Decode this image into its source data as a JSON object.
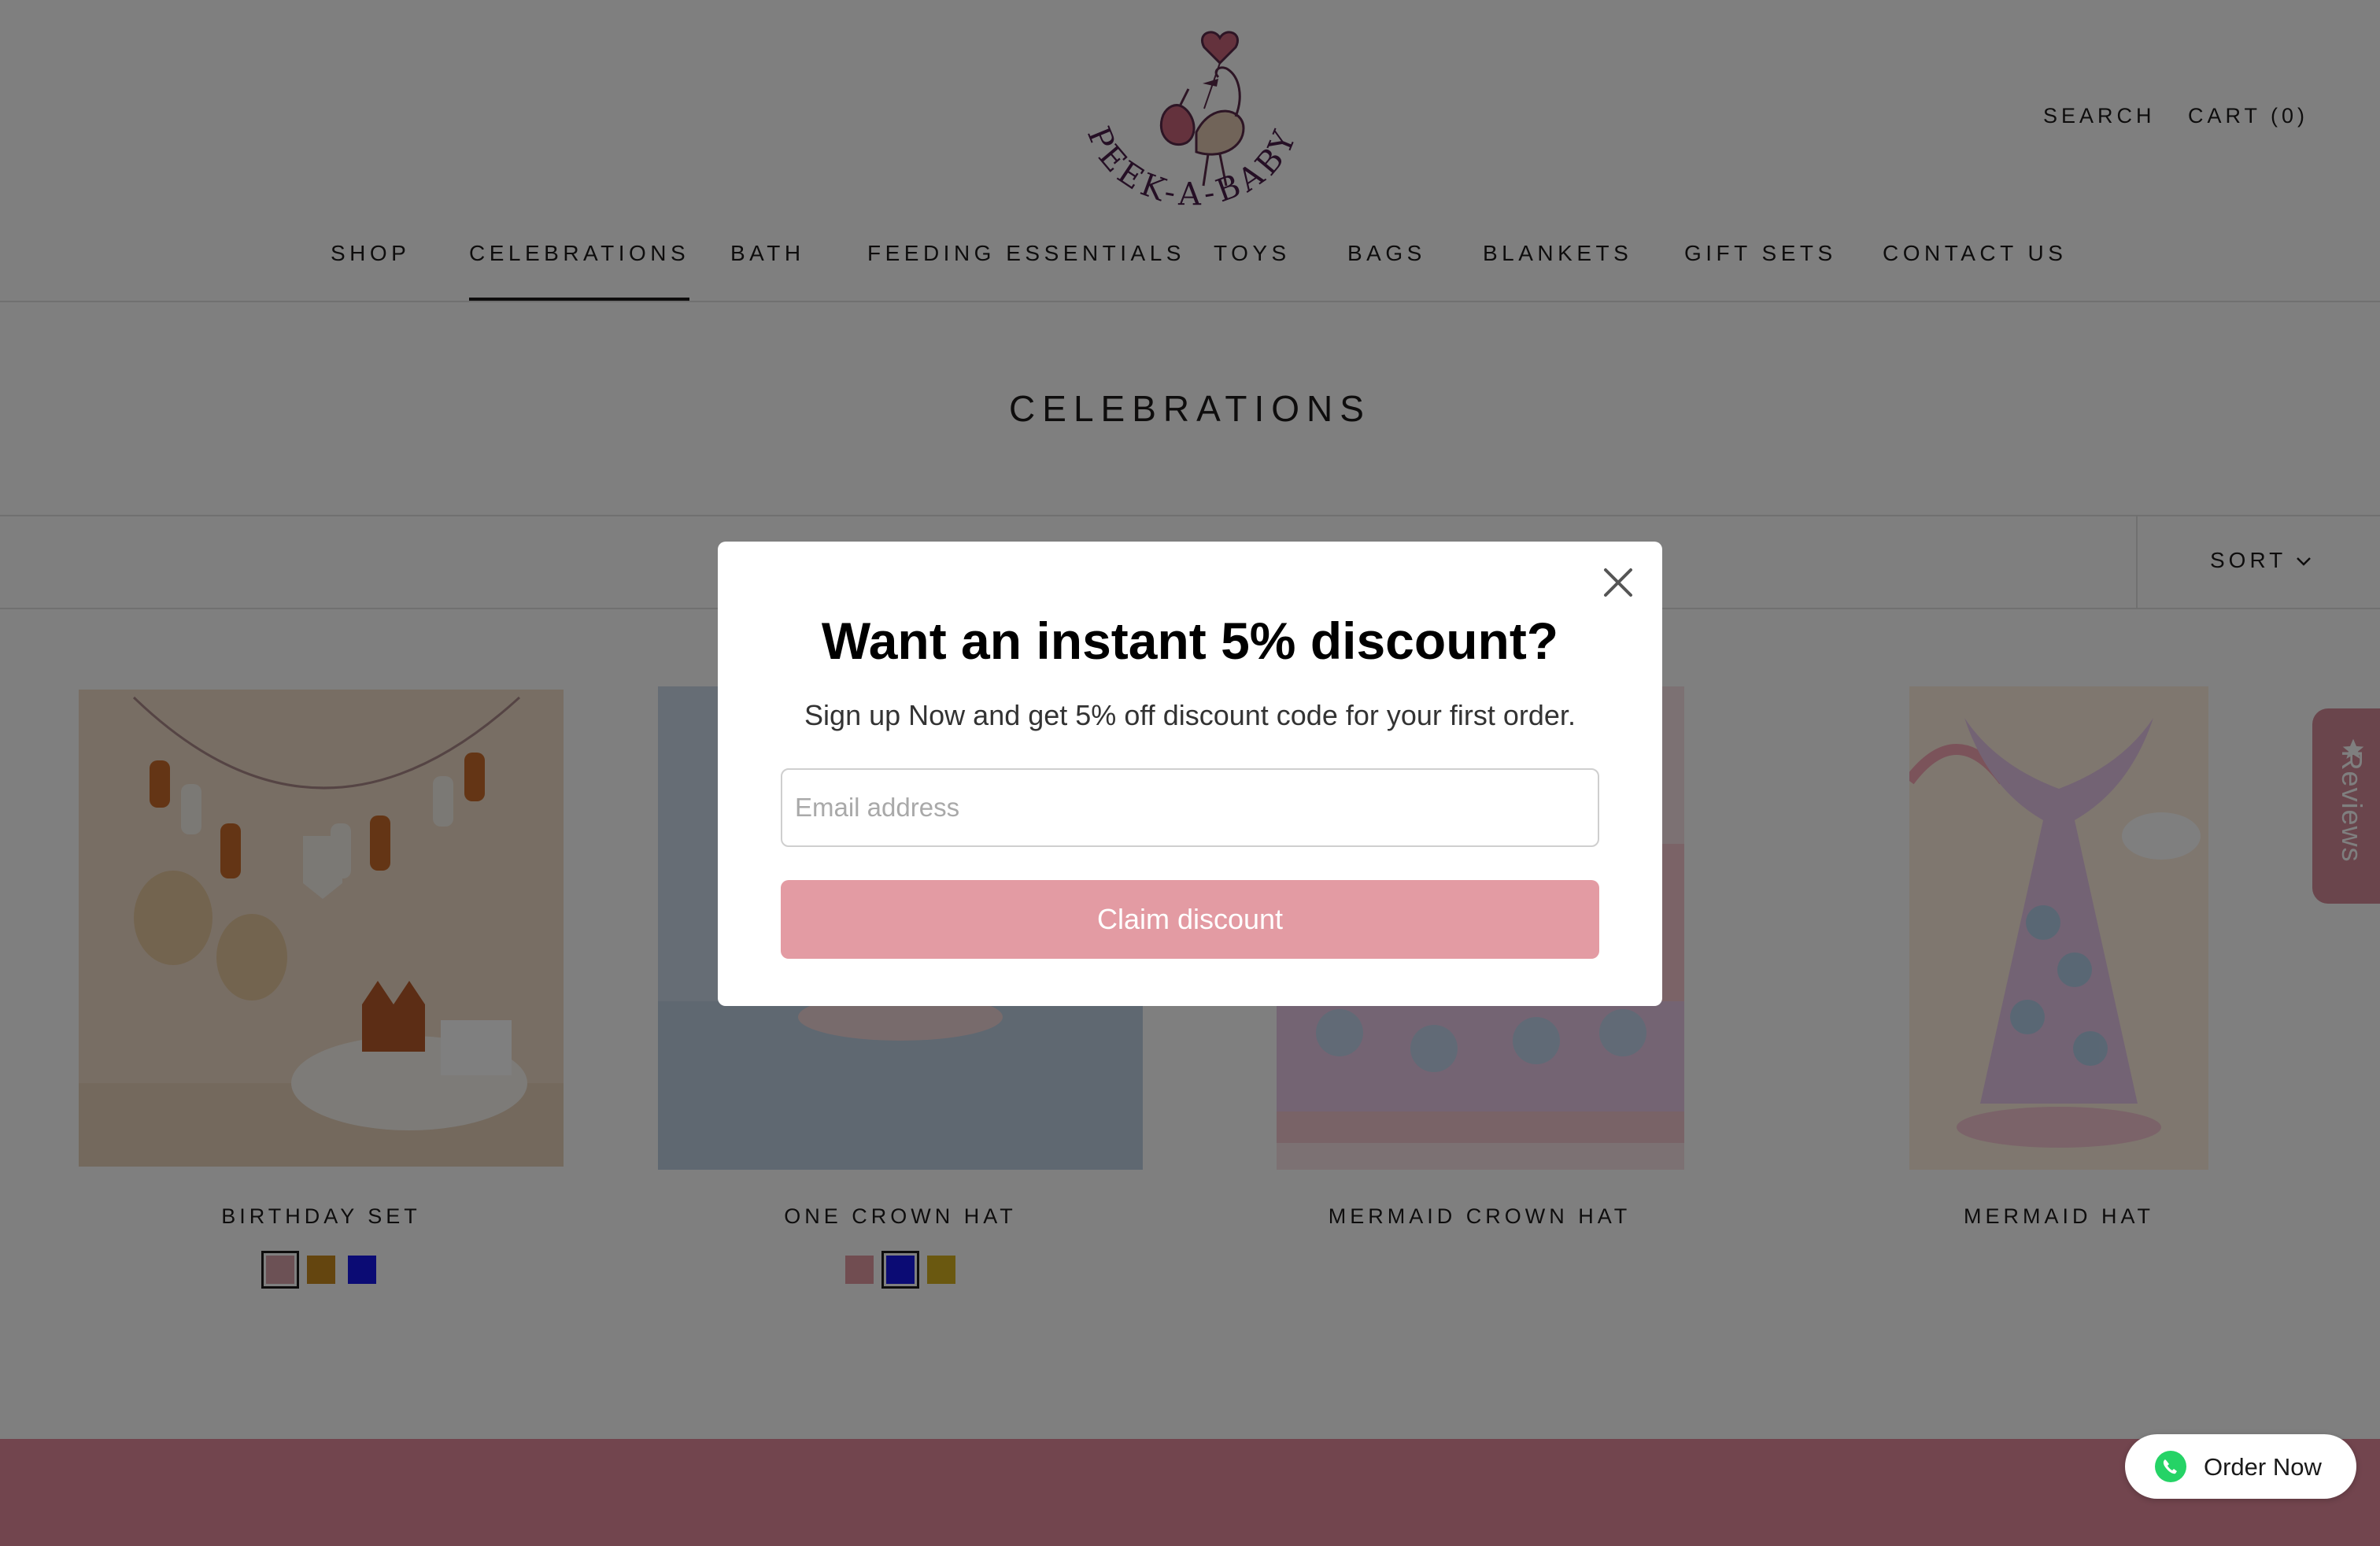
{
  "brand": {
    "logo_text": "PEEK-A-BABY"
  },
  "header": {
    "search_label": "SEARCH",
    "cart_label": "CART (0)"
  },
  "nav": {
    "items": [
      {
        "label": "SHOP"
      },
      {
        "label": "CELEBRATIONS",
        "active": true
      },
      {
        "label": "BATH"
      },
      {
        "label": "FEEDING ESSENTIALS"
      },
      {
        "label": "TOYS"
      },
      {
        "label": "BAGS"
      },
      {
        "label": "BLANKETS"
      },
      {
        "label": "GIFT SETS"
      },
      {
        "label": "CONTACT US"
      }
    ]
  },
  "collection": {
    "title": "CELEBRATIONS",
    "sort_label": "SORT"
  },
  "products": [
    {
      "name": "BIRTHDAY SET",
      "swatches": [
        "#d9a2aa",
        "#c88a1e",
        "#1717e8"
      ],
      "selected_swatch": 0
    },
    {
      "name": "ONE CROWN HAT",
      "swatches": [
        "#e39ba3",
        "#1717e8",
        "#d4b020"
      ],
      "selected_swatch": 1
    },
    {
      "name": "MERMAID CROWN HAT",
      "swatches": [],
      "selected_swatch": null
    },
    {
      "name": "MERMAID HAT",
      "swatches": [],
      "selected_swatch": null
    }
  ],
  "reviews_tab": {
    "label": "Reviews",
    "icon": "star-icon"
  },
  "popup": {
    "heading": "Want an instant 5% discount?",
    "subtext": "Sign up Now and get 5% off discount code for your first order.",
    "email_placeholder": "Email address",
    "email_value": "",
    "button_label": "Claim discount",
    "close_icon": "close-icon"
  },
  "order_now": {
    "label": "Order Now",
    "icon": "whatsapp-icon"
  },
  "colors": {
    "accent_pink": "#e39ba3",
    "footer_band": "#e48b9c",
    "reviews_tab": "#d48a98",
    "text": "#1c1b1b"
  }
}
